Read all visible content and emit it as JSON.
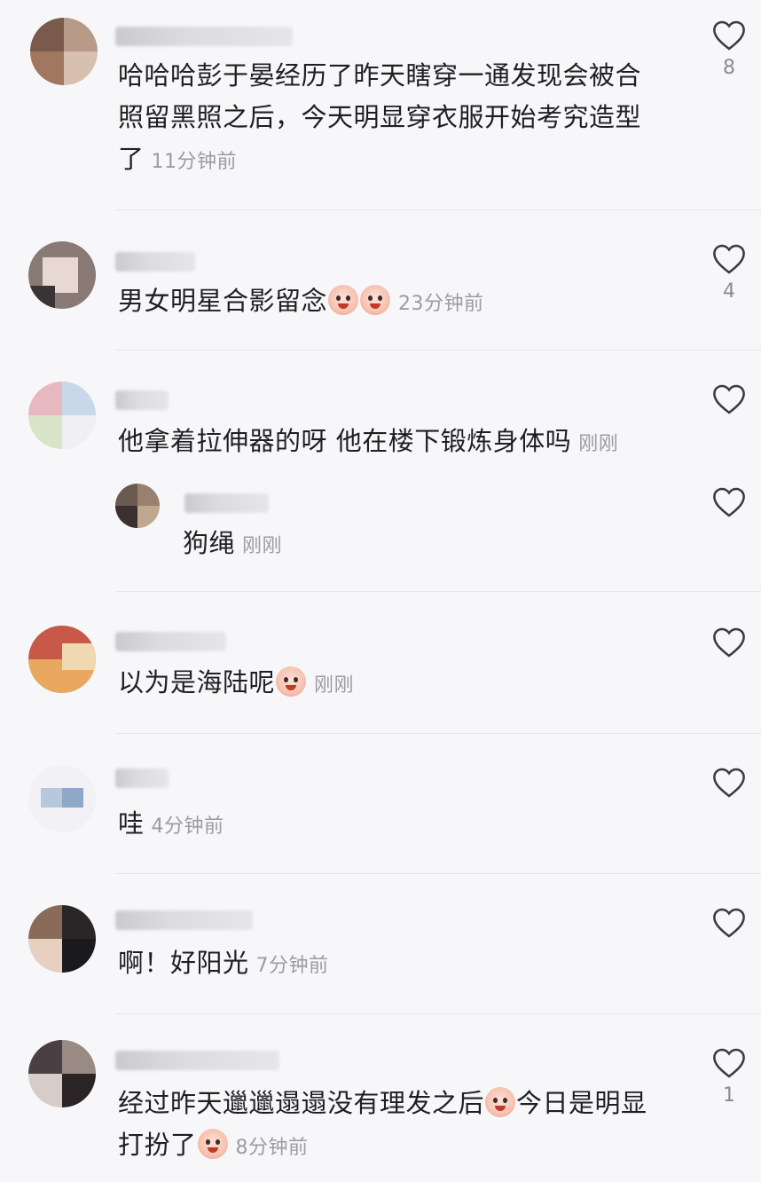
{
  "comments": [
    {
      "text": "哈哈哈彭于晏经历了昨天瞎穿一通发现会被合",
      "text2": "照留黑照之后，今天明显穿衣服开始考究造型",
      "text3": "了",
      "time": "11分钟前",
      "likes": "8"
    },
    {
      "text": "男女明星合影留念",
      "emoji": "crying-face",
      "time": "23分钟前",
      "likes": "4"
    },
    {
      "text": "他拿着拉伸器的呀 他在楼下锻炼身体吗",
      "time": "刚刚",
      "likes": "",
      "reply": {
        "text": "狗绳",
        "time": "刚刚"
      }
    },
    {
      "text": "以为是海陆呢",
      "emoji": "crying-face",
      "time": "刚刚",
      "likes": ""
    },
    {
      "text": "哇",
      "time": "4分钟前",
      "likes": ""
    },
    {
      "text": "啊！好阳光",
      "time": "7分钟前",
      "likes": ""
    },
    {
      "text": "经过昨天邋邋遢遢没有理发之后",
      "text2": "今日是明显",
      "text3": "打扮了",
      "emoji": "crying-face",
      "time": "8分钟前",
      "likes": "1"
    }
  ],
  "icons": {
    "like": "heart-outline-icon"
  },
  "colors": {
    "background": "#f7f7fa",
    "text": "#1f1f1f",
    "meta": "#9b9ba3"
  }
}
